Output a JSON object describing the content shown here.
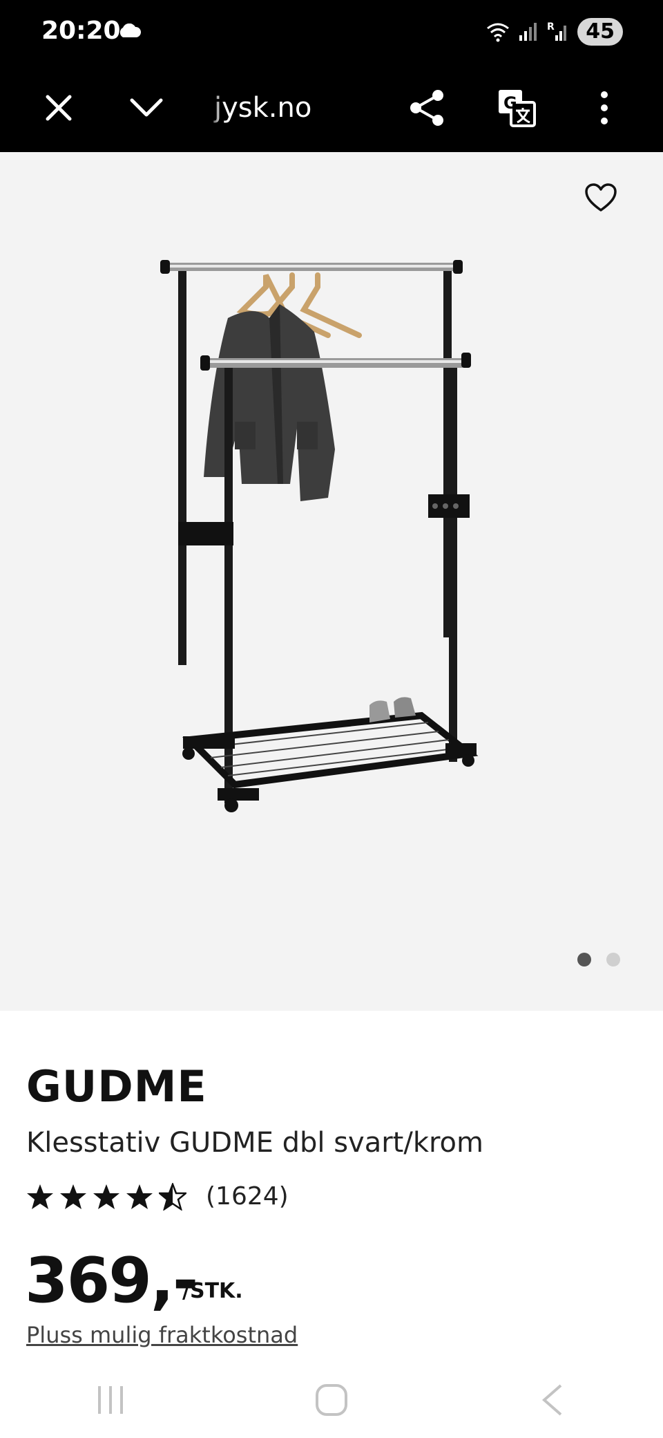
{
  "status_bar": {
    "time": "20:20",
    "battery": "45",
    "icons": [
      "cloud-icon",
      "wifi-icon",
      "signal-icon",
      "roaming-signal-icon"
    ]
  },
  "browser": {
    "url": "jysk.no",
    "icons": [
      "close-icon",
      "chevron-down-icon",
      "share-icon",
      "translate-icon",
      "more-vertical-icon"
    ]
  },
  "gallery": {
    "favorite_icon": "heart-icon",
    "image_count": 2,
    "active_index": 0
  },
  "product": {
    "brand": "GUDME",
    "name": "Klesstativ GUDME dbl svart/krom",
    "rating": 4.5,
    "rating_count": "(1624)",
    "price": "369,-",
    "unit": "/STK.",
    "shipping_note": "Pluss mulig fraktkostnad"
  },
  "colors": {
    "header_bg": "#000000",
    "gallery_bg": "#f3f3f3",
    "text": "#111111"
  }
}
